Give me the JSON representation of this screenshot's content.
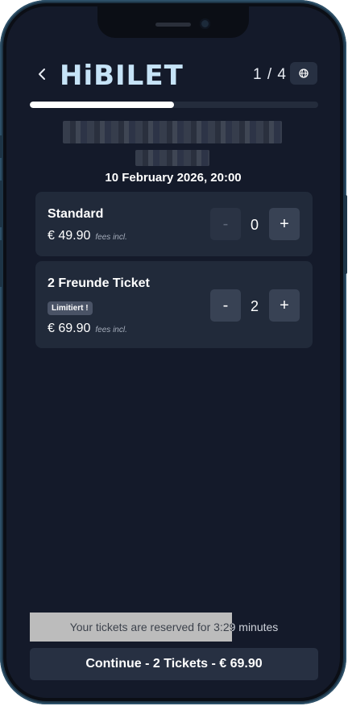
{
  "header": {
    "back_icon": "chevron-left-icon",
    "logo_text": "HiBILET",
    "step_counter": "1 / 4",
    "language_icon": "globe-icon"
  },
  "progress": {
    "fraction": 0.5
  },
  "event": {
    "title_redacted": true,
    "venue_redacted": true,
    "date": "10 February 2026, 20:00"
  },
  "tickets": [
    {
      "name": "Standard",
      "badge": "",
      "price": "€ 49.90",
      "fees_label": "fees incl.",
      "decrement_label": "-",
      "quantity": "0",
      "increment_label": "+",
      "decrement_disabled": true
    },
    {
      "name": "2 Freunde Ticket",
      "badge": "Limitiert !",
      "price": "€ 69.90",
      "fees_label": "fees incl.",
      "decrement_label": "-",
      "quantity": "2",
      "increment_label": "+",
      "decrement_disabled": false
    }
  ],
  "reservation": {
    "text": "Your tickets are reserved for 3:29 minutes",
    "remaining_fraction": 0.7
  },
  "footer": {
    "continue_label": "Continue - 2 Tickets - € 69.90"
  },
  "colors": {
    "background": "#141a2a",
    "card": "#212a3a",
    "button": "#384254",
    "logo": "#c6e3f7"
  }
}
